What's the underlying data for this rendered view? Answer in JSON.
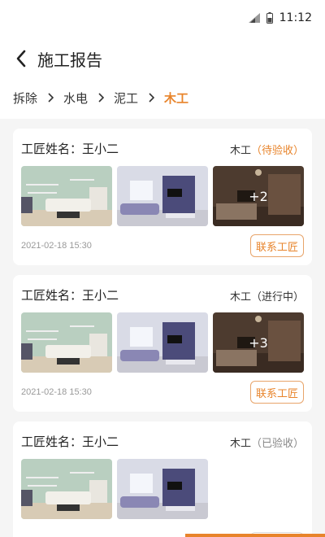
{
  "status_bar": {
    "time": "11:12",
    "signal_icon": "signal-icon",
    "battery_icon": "battery-icon"
  },
  "header": {
    "title": "施工报告",
    "back_icon": "chevron-left-icon"
  },
  "breadcrumb": {
    "items": [
      {
        "label": "拆除",
        "active": false
      },
      {
        "label": "水电",
        "active": false
      },
      {
        "label": "泥工",
        "active": false
      },
      {
        "label": "木工",
        "active": true
      }
    ],
    "separator_icon": "chevron-right-icon"
  },
  "cards": [
    {
      "name_label": "工匠姓名：",
      "name": "王小二",
      "trade": "木工",
      "status_open": "（",
      "status": "待验收",
      "status_close": "）",
      "more_count": "+2",
      "time": "2021-02-18  15:30",
      "contact_label": "联系工匠"
    },
    {
      "name_label": "工匠姓名：",
      "name": "王小二",
      "trade": "木工",
      "status_open": "（",
      "status": "进行中",
      "status_close": "）",
      "more_count": "+3",
      "time": "2021-02-18  15:30",
      "contact_label": "联系工匠"
    },
    {
      "name_label": "工匠姓名：",
      "name": "王小二",
      "trade": "木工",
      "status_open": "（",
      "status": "已验收",
      "status_close": "）",
      "more_count": "",
      "time": "",
      "contact_label": ""
    }
  ],
  "colors": {
    "accent": "#e8842b",
    "background": "#f5f5f5",
    "card": "#ffffff"
  }
}
